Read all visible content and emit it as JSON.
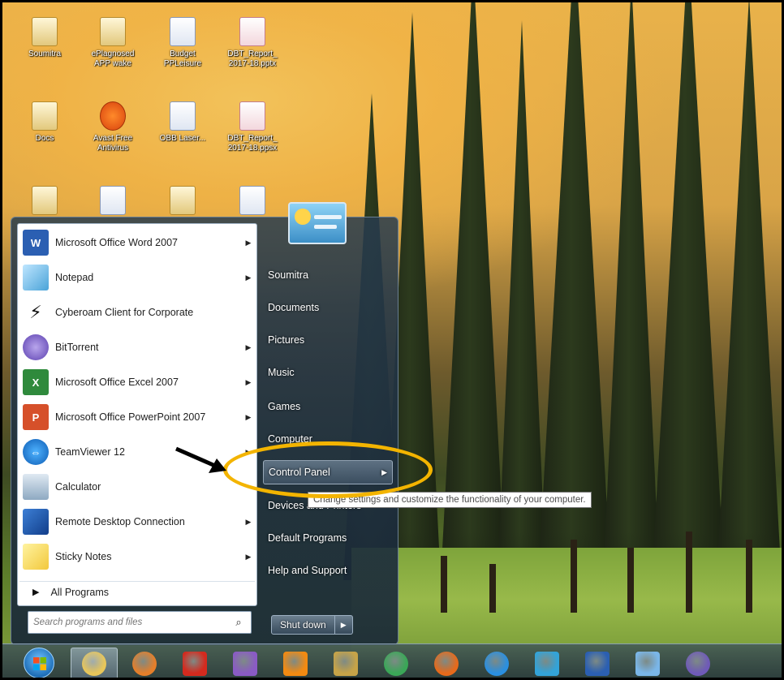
{
  "desktop": {
    "icons": [
      {
        "label": "Soumitra",
        "icon": "folder-icon"
      },
      {
        "label": "ePlagnosed APP wake",
        "icon": "folder-icon"
      },
      {
        "label": "Budget PPLeisure",
        "icon": "document-icon"
      },
      {
        "label": "DBT_Report_ 2017-18.pptx",
        "icon": "presentation-icon"
      },
      {
        "label": "Docs",
        "icon": "folder-icon"
      },
      {
        "label": "Avast Free Antivirus",
        "icon": "avast-icon"
      },
      {
        "label": "OBB Laser...",
        "icon": "document-icon"
      },
      {
        "label": "DBT_Report_ 2017-18.ppsx",
        "icon": "presentation-icon"
      }
    ]
  },
  "start_menu": {
    "programs": [
      {
        "name": "Microsoft Office Word 2007",
        "icon": "word-icon",
        "has_submenu": true
      },
      {
        "name": "Notepad",
        "icon": "notepad-icon",
        "has_submenu": true
      },
      {
        "name": "Cyberoam Client for Corporate",
        "icon": "cyberoam-icon",
        "has_submenu": false
      },
      {
        "name": "BitTorrent",
        "icon": "bittorrent-icon",
        "has_submenu": true
      },
      {
        "name": "Microsoft Office Excel 2007",
        "icon": "excel-icon",
        "has_submenu": true
      },
      {
        "name": "Microsoft Office PowerPoint 2007",
        "icon": "powerpoint-icon",
        "has_submenu": true
      },
      {
        "name": "TeamViewer 12",
        "icon": "teamviewer-icon",
        "has_submenu": true
      },
      {
        "name": "Calculator",
        "icon": "calculator-icon",
        "has_submenu": false
      },
      {
        "name": "Remote Desktop Connection",
        "icon": "remote-desktop-icon",
        "has_submenu": true
      },
      {
        "name": "Sticky Notes",
        "icon": "sticky-notes-icon",
        "has_submenu": true
      }
    ],
    "all_programs": "All Programs",
    "search_placeholder": "Search programs and files",
    "right_items": [
      {
        "label": "Soumitra",
        "highlighted": false
      },
      {
        "label": "Documents",
        "highlighted": false
      },
      {
        "label": "Pictures",
        "highlighted": false
      },
      {
        "label": "Music",
        "highlighted": false
      },
      {
        "label": "Games",
        "highlighted": false
      },
      {
        "label": "Computer",
        "highlighted": false
      },
      {
        "label": "Control Panel",
        "highlighted": true
      },
      {
        "label": "Devices and Printers",
        "highlighted": false
      },
      {
        "label": "Default Programs",
        "highlighted": false
      },
      {
        "label": "Help and Support",
        "highlighted": false
      }
    ],
    "shutdown_label": "Shut down",
    "tooltip": "Change settings and customize the functionality of your computer."
  },
  "annotation": {
    "color": "#f3b400"
  },
  "taskbar": {
    "items": [
      {
        "icon": "explorer-icon",
        "color": "#e8c65a",
        "active": true
      },
      {
        "icon": "media-player-icon",
        "color": "#e57f2a",
        "active": false
      },
      {
        "icon": "acrobat-icon",
        "color": "#d42a1e",
        "active": false
      },
      {
        "icon": "visual-studio-icon",
        "color": "#8a5bc4",
        "active": false
      },
      {
        "icon": "vlc-icon",
        "color": "#f28a12",
        "active": false
      },
      {
        "icon": "tool-icon",
        "color": "#c6a348",
        "active": false
      },
      {
        "icon": "chrome-icon",
        "color": "#3aa757",
        "active": false
      },
      {
        "icon": "firefox-icon",
        "color": "#e66a1b",
        "active": false
      },
      {
        "icon": "internet-explorer-icon",
        "color": "#2a8fe0",
        "active": false
      },
      {
        "icon": "messenger-icon",
        "color": "#33a3d8",
        "active": false
      },
      {
        "icon": "word-icon",
        "color": "#2b5fb2",
        "active": false
      },
      {
        "icon": "network-icon",
        "color": "#7ab6e8",
        "active": false
      },
      {
        "icon": "bittorrent-icon",
        "color": "#6f5ab8",
        "active": false
      }
    ]
  }
}
